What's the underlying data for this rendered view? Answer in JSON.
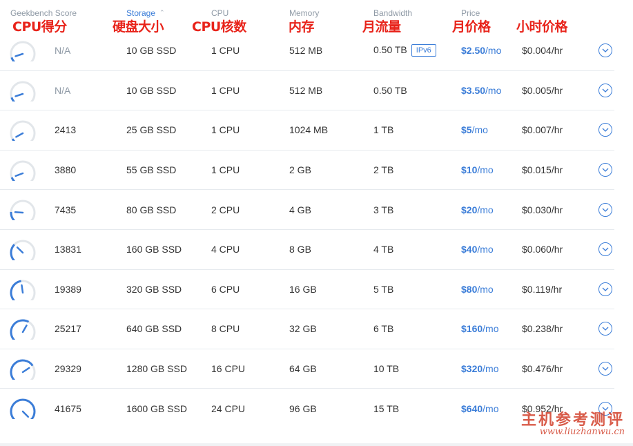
{
  "colors": {
    "accent": "#3b7dd8",
    "annotation": "#e8231a",
    "muted": "#8f9aa6",
    "gauge_track": "#e2e6ea"
  },
  "header": {
    "geekbench": "Geekbench Score",
    "storage": "Storage",
    "cpu": "CPU",
    "memory": "Memory",
    "bandwidth": "Bandwidth",
    "price": "Price"
  },
  "annotations": {
    "cpu_score": "CPU得分",
    "disk_size": "硬盘大小",
    "cpu_cores": "CPU核数",
    "memory": "内存",
    "monthly_traffic": "月流量",
    "monthly_price": "月价格",
    "hourly_price": "小时价格"
  },
  "plans": [
    {
      "score": "N/A",
      "score_level": 0.1,
      "storage": "10 GB SSD",
      "cpu": "1 CPU",
      "memory": "512 MB",
      "bandwidth": "0.50 TB",
      "badge": "IPv6",
      "price": "$2.50",
      "per": "/mo",
      "hourly": "$0.004/hr"
    },
    {
      "score": "N/A",
      "score_level": 0.1,
      "storage": "10 GB SSD",
      "cpu": "1 CPU",
      "memory": "512 MB",
      "bandwidth": "0.50 TB",
      "badge": "",
      "price": "$3.50",
      "per": "/mo",
      "hourly": "$0.005/hr"
    },
    {
      "score": "2413",
      "score_level": 0.06,
      "storage": "25 GB SSD",
      "cpu": "1 CPU",
      "memory": "1024 MB",
      "bandwidth": "1 TB",
      "badge": "",
      "price": "$5",
      "per": "/mo",
      "hourly": "$0.007/hr"
    },
    {
      "score": "3880",
      "score_level": 0.09,
      "storage": "55 GB SSD",
      "cpu": "1 CPU",
      "memory": "2 GB",
      "bandwidth": "2 TB",
      "badge": "",
      "price": "$10",
      "per": "/mo",
      "hourly": "$0.015/hr"
    },
    {
      "score": "7435",
      "score_level": 0.18,
      "storage": "80 GB SSD",
      "cpu": "2 CPU",
      "memory": "4 GB",
      "bandwidth": "3 TB",
      "badge": "",
      "price": "$20",
      "per": "/mo",
      "hourly": "$0.030/hr"
    },
    {
      "score": "13831",
      "score_level": 0.33,
      "storage": "160 GB SSD",
      "cpu": "4 CPU",
      "memory": "8 GB",
      "bandwidth": "4 TB",
      "badge": "",
      "price": "$40",
      "per": "/mo",
      "hourly": "$0.060/hr"
    },
    {
      "score": "19389",
      "score_level": 0.47,
      "storage": "320 GB SSD",
      "cpu": "6 CPU",
      "memory": "16 GB",
      "bandwidth": "5 TB",
      "badge": "",
      "price": "$80",
      "per": "/mo",
      "hourly": "$0.119/hr"
    },
    {
      "score": "25217",
      "score_level": 0.61,
      "storage": "640 GB SSD",
      "cpu": "8 CPU",
      "memory": "32 GB",
      "bandwidth": "6 TB",
      "badge": "",
      "price": "$160",
      "per": "/mo",
      "hourly": "$0.238/hr"
    },
    {
      "score": "29329",
      "score_level": 0.71,
      "storage": "1280 GB SSD",
      "cpu": "16 CPU",
      "memory": "64 GB",
      "bandwidth": "10 TB",
      "badge": "",
      "price": "$320",
      "per": "/mo",
      "hourly": "$0.476/hr"
    },
    {
      "score": "41675",
      "score_level": 1.0,
      "storage": "1600 GB SSD",
      "cpu": "24 CPU",
      "memory": "96 GB",
      "bandwidth": "15 TB",
      "badge": "",
      "price": "$640",
      "per": "/mo",
      "hourly": "$0.952/hr"
    }
  ],
  "watermark": {
    "title": "主机参考测评",
    "url": "www.liuzhanwu.cn"
  }
}
